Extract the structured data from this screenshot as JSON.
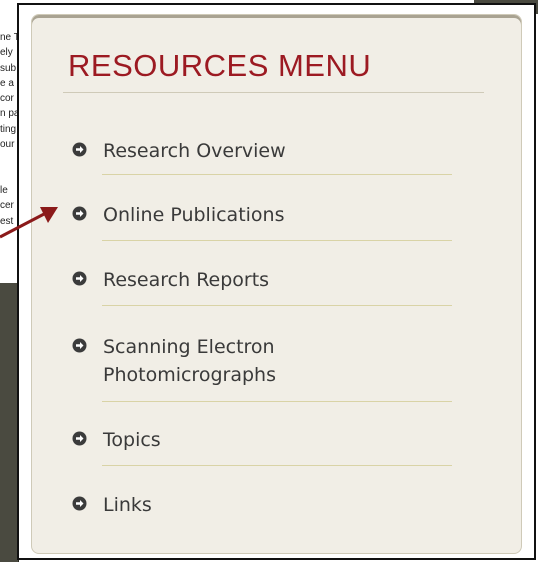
{
  "background": {
    "text_fragments": [
      "ne T",
      "ely",
      "sub",
      "e a",
      "cor",
      "n pa",
      "ting",
      "our",
      "",
      "",
      "le",
      "cer",
      "est"
    ]
  },
  "panel": {
    "title": "RESOURCES MENU",
    "items": [
      {
        "label": "Research Overview"
      },
      {
        "label": "Online Publications"
      },
      {
        "label": "Research Reports"
      },
      {
        "label": "Scanning Electron\nPhotomicrographs",
        "line1": "Scanning Electron",
        "line2": "Photomicrographs"
      },
      {
        "label": "Topics"
      },
      {
        "label": "Links"
      }
    ]
  },
  "colors": {
    "title": "#9c1a22",
    "panel_bg": "#f1eee6",
    "divider": "#d9d3a6",
    "arrow": "#8b1a1a"
  },
  "icons": {
    "bullet": "right-arrow-circle-icon",
    "pointer": "red-arrow-icon"
  }
}
